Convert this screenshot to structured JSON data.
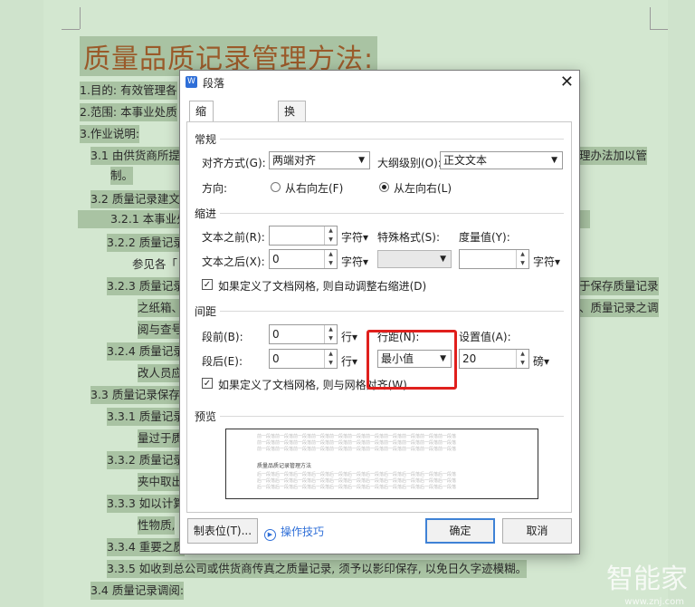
{
  "document": {
    "title": "质量品质记录管理方法:",
    "lines": [
      "1.目的:  有效管理各",
      "2.范围:  本事业处质",
      "3.作业说明:",
      "3.1 由供货商所提",
      "理办法加以管",
      "制。",
      "3.2 质量记录建文",
      "3.2.1 本事业处",
      "3.2.2 质量记录",
      "参见各「",
      "3.2.3 质量记录",
      "于保存质量记录",
      "之纸箱、",
      "、质量记录之调",
      "阅与查号",
      "3.2.4 质量记录",
      "改人员应",
      "3.3 质量记录保存",
      "3.3.1 质量记录",
      "量过于质",
      "3.3.2 质量记录",
      "夹中取出",
      "3.3.3 如以计算",
      "性物质,",
      "3.3.4 重要之质",
      "3.3.5 如收到总公司或供货商传真之质量记录,  须予以影印保存,  以免日久字迹模糊。",
      "3.4 质量记录调阅:"
    ],
    "watermark": "智能家",
    "watermark_url": "www.znj.com"
  },
  "dialog": {
    "app_icon": "W",
    "title": "段落",
    "close": "✕",
    "tabs": [
      "缩进和间距(I)",
      "换行和分页(P)"
    ],
    "general": {
      "section": "常规",
      "align_label": "对齐方式(G):",
      "align_value": "两端对齐",
      "outline_label": "大纲级别(O):",
      "outline_value": "正文文本",
      "direction_label": "方向:",
      "rtl": "从右向左(F)",
      "ltr": "从左向右(L)"
    },
    "indent": {
      "section": "缩进",
      "before_label": "文本之前(R):",
      "before_value": "",
      "before_unit": "字符▾",
      "special_label": "特殊格式(S):",
      "special_value": "",
      "measure_label": "度量值(Y):",
      "measure_value": "",
      "measure_unit": "字符▾",
      "after_label": "文本之后(X):",
      "after_value": "0",
      "after_unit": "字符▾",
      "auto_adjust": "如果定义了文档网格,  则自动调整右缩进(D)"
    },
    "spacing": {
      "section": "间距",
      "before_label": "段前(B):",
      "before_value": "0",
      "before_unit": "行▾",
      "line_label": "行距(N):",
      "line_value": "最小值",
      "setting_label": "设置值(A):",
      "setting_value": "20",
      "setting_unit": "磅▾",
      "after_label": "段后(E):",
      "after_value": "0",
      "after_unit": "行▾",
      "grid_align": "如果定义了文档网格,  则与网格对齐(W)"
    },
    "preview": {
      "section": "预览",
      "prev_text": "前一段落前一段落前一段落前一段落前一段落前一段落前一段落前一段落前一段落前一段落前一段落",
      "doc_text": "质量品质记录管理方法",
      "next_text": "后一段落后一段落后一段落后一段落后一段落后一段落后一段落后一段落后一段落后一段落后一段落"
    },
    "tabs_button": "制表位(T)...",
    "tips_link": "操作技巧",
    "ok": "确定",
    "cancel": "取消"
  },
  "colors": {
    "highlight_box": "#e0201d",
    "accent": "#3f82d6"
  }
}
